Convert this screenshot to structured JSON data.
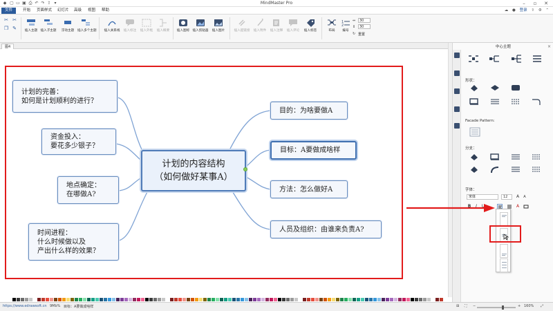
{
  "app": {
    "title": "MindMaster Pro"
  },
  "menu": {
    "tabs": [
      "文件",
      "开始",
      "页面样式",
      "幻灯片",
      "高级",
      "视图",
      "帮助"
    ],
    "active_index": 0
  },
  "user": {
    "login_label": "登录"
  },
  "ribbon": {
    "groups": [
      {
        "label": "插入主题",
        "icon": "insert-topic-icon",
        "disabled": false
      },
      {
        "label": "插入子主题",
        "icon": "insert-subtopic-icon",
        "disabled": false
      },
      {
        "label": "浮动主题",
        "icon": "floating-topic-icon",
        "disabled": false
      },
      {
        "label": "插入多个主题",
        "icon": "insert-multiple-topics-icon",
        "disabled": false
      },
      {
        "label": "插入关系线",
        "icon": "relationship-icon",
        "disabled": false
      },
      {
        "label": "插入标注",
        "icon": "callout-icon",
        "disabled": true
      },
      {
        "label": "插入外框",
        "icon": "boundary-icon",
        "disabled": true
      },
      {
        "label": "插入概要",
        "icon": "summary-icon",
        "disabled": true
      },
      {
        "label": "插入图标",
        "icon": "insert-icon-icon",
        "disabled": false
      },
      {
        "label": "插入剪贴画",
        "icon": "clipart-icon",
        "disabled": false
      },
      {
        "label": "插入图片",
        "icon": "picture-icon",
        "disabled": false
      },
      {
        "label": "插入超链接",
        "icon": "hyperlink-icon",
        "disabled": true
      },
      {
        "label": "插入附件",
        "icon": "attachment-icon",
        "disabled": true
      },
      {
        "label": "插入注释",
        "icon": "note-icon",
        "disabled": true
      },
      {
        "label": "插入评论",
        "icon": "comment-icon",
        "disabled": true
      },
      {
        "label": "插入标签",
        "icon": "tag-icon",
        "disabled": false
      },
      {
        "label": "布局",
        "icon": "layout-icon",
        "disabled": false
      },
      {
        "label": "编号",
        "icon": "numbering-icon",
        "disabled": false
      }
    ],
    "spacing_values": [
      "30",
      "30"
    ],
    "reset_label": "重置"
  },
  "document": {
    "tab_label": "图4"
  },
  "mindmap": {
    "center": {
      "text": "计划的内容结构\n（如何做好某事A）"
    },
    "left_topics": [
      {
        "text": "计划的完善：\n如何是计划顺利的进行？"
      },
      {
        "text": "资金投入：\n要花多少银子？"
      },
      {
        "text": "地点确定：\n在哪做A?"
      },
      {
        "text": "时间进程：\n什么时候做以及\n产出什么样的效果？"
      }
    ],
    "right_topics": [
      {
        "text": "目的：为啥要做A"
      },
      {
        "text": "目标：A要做成啥样"
      },
      {
        "text": "方法：怎么做好A"
      },
      {
        "text": "人员及组织：由谁来负责A?"
      }
    ],
    "selected_right_index": 1
  },
  "panel": {
    "title": "中心主题",
    "sections": {
      "shape": "形状：",
      "facade": "Facade Pattern:",
      "branch": "分支：",
      "font": "字体："
    },
    "font_family": "宋体",
    "font_size": "12",
    "format_buttons": [
      "B",
      "I",
      "U",
      "A"
    ]
  },
  "statusbar": {
    "url": "https://www.edrawsoft.cn",
    "size": "9Mb%",
    "target": "目标：A要做成啥样",
    "zoom": "160%"
  },
  "colors": {
    "accent": "#2b5b9c",
    "annotation_red": "#e21b1b",
    "branch_line": "#7fa3d4",
    "node_border": "#6b8fbf",
    "node_fill": "#f4f7fc"
  }
}
